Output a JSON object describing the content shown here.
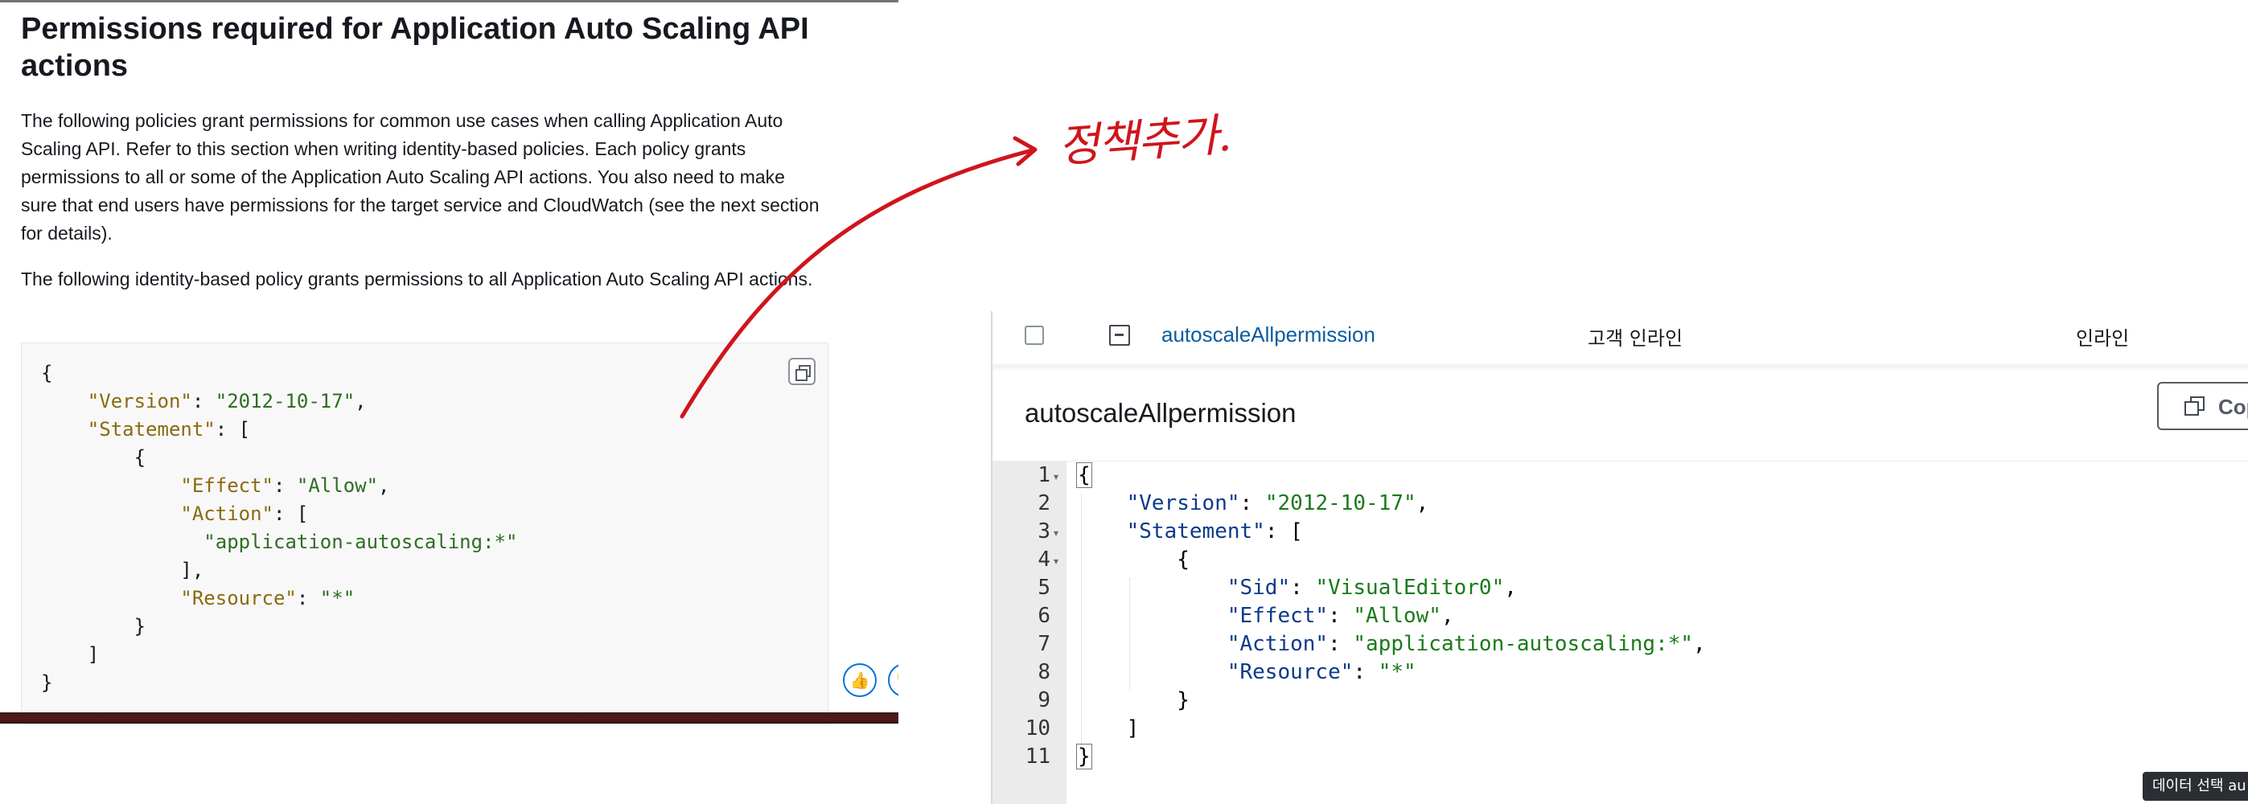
{
  "doc": {
    "title": "Permissions required for Application Auto Scaling API actions",
    "paragraph1": "The following policies grant permissions for common use cases when calling Application Auto Scaling API. Refer to this section when writing identity-based policies. Each policy grants permissions to all or some of the Application Auto Scaling API actions. You also need to make sure that end users have permissions for the target service and CloudWatch (see the next section for details).",
    "paragraph2": "The following identity-based policy grants permissions to all Application Auto Scaling API actions.",
    "code": {
      "open_brace": "{",
      "version_key": "\"Version\"",
      "version_val": "\"2012-10-17\"",
      "statement_key": "\"Statement\"",
      "effect_key": "\"Effect\"",
      "effect_val": "\"Allow\"",
      "action_key": "\"Action\"",
      "action_item": "\"application-autoscaling:*\"",
      "resource_key": "\"Resource\"",
      "resource_val": "\"*\"",
      "close_brace": "}"
    },
    "feedback_up_icon": "thumbs-up-icon",
    "feedback_down_icon": "thumbs-down-icon"
  },
  "annotation": {
    "text": "정책추가.",
    "color": "#d0141c"
  },
  "iam": {
    "policy_name": "autoscaleAllpermission",
    "policy_type": "고객 인라인",
    "policy_type_col2": "인라인",
    "detail_title": "autoscaleAllpermission",
    "copy_label": "Cop",
    "line_numbers": [
      "1",
      "2",
      "3",
      "4",
      "5",
      "6",
      "7",
      "8",
      "9",
      "10",
      "11"
    ],
    "code": {
      "sid_key": "\"Sid\"",
      "sid_val": "\"VisualEditor0\"",
      "version_key": "\"Version\"",
      "version_val": "\"2012-10-17\"",
      "statement_key": "\"Statement\"",
      "effect_key": "\"Effect\"",
      "effect_val": "\"Allow\"",
      "action_key": "\"Action\"",
      "action_val": "\"application-autoscaling:*\"",
      "resource_key": "\"Resource\"",
      "resource_val": "\"*\""
    },
    "tooltip": "데이터 선택 au"
  }
}
